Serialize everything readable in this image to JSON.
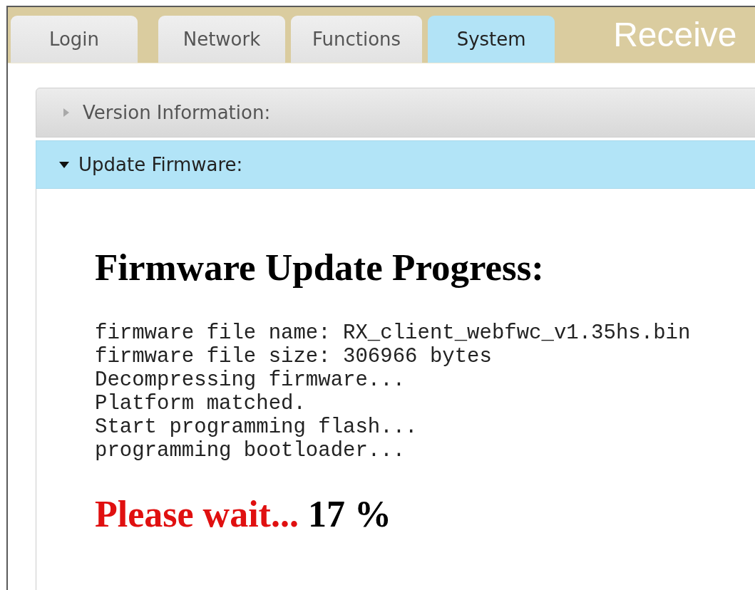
{
  "header": {
    "tabs": [
      {
        "label": "Login",
        "selected": false
      },
      {
        "label": "Network",
        "selected": false
      },
      {
        "label": "Functions",
        "selected": false
      },
      {
        "label": "System",
        "selected": true
      }
    ],
    "title": "Receive"
  },
  "accordion": [
    {
      "title": "Version Information:",
      "expanded": false
    },
    {
      "title": "Update Firmware:",
      "expanded": true,
      "content": {
        "heading": "Firmware Update Progress:",
        "log": [
          "firmware file name: RX_client_webfwc_v1.35hs.bin",
          "firmware file size: 306966 bytes",
          "Decompressing firmware...",
          "Platform matched.",
          "Start programming flash...",
          "programming bootloader..."
        ],
        "status": {
          "message": "Please wait...",
          "percent": "17 %"
        }
      }
    }
  ]
}
